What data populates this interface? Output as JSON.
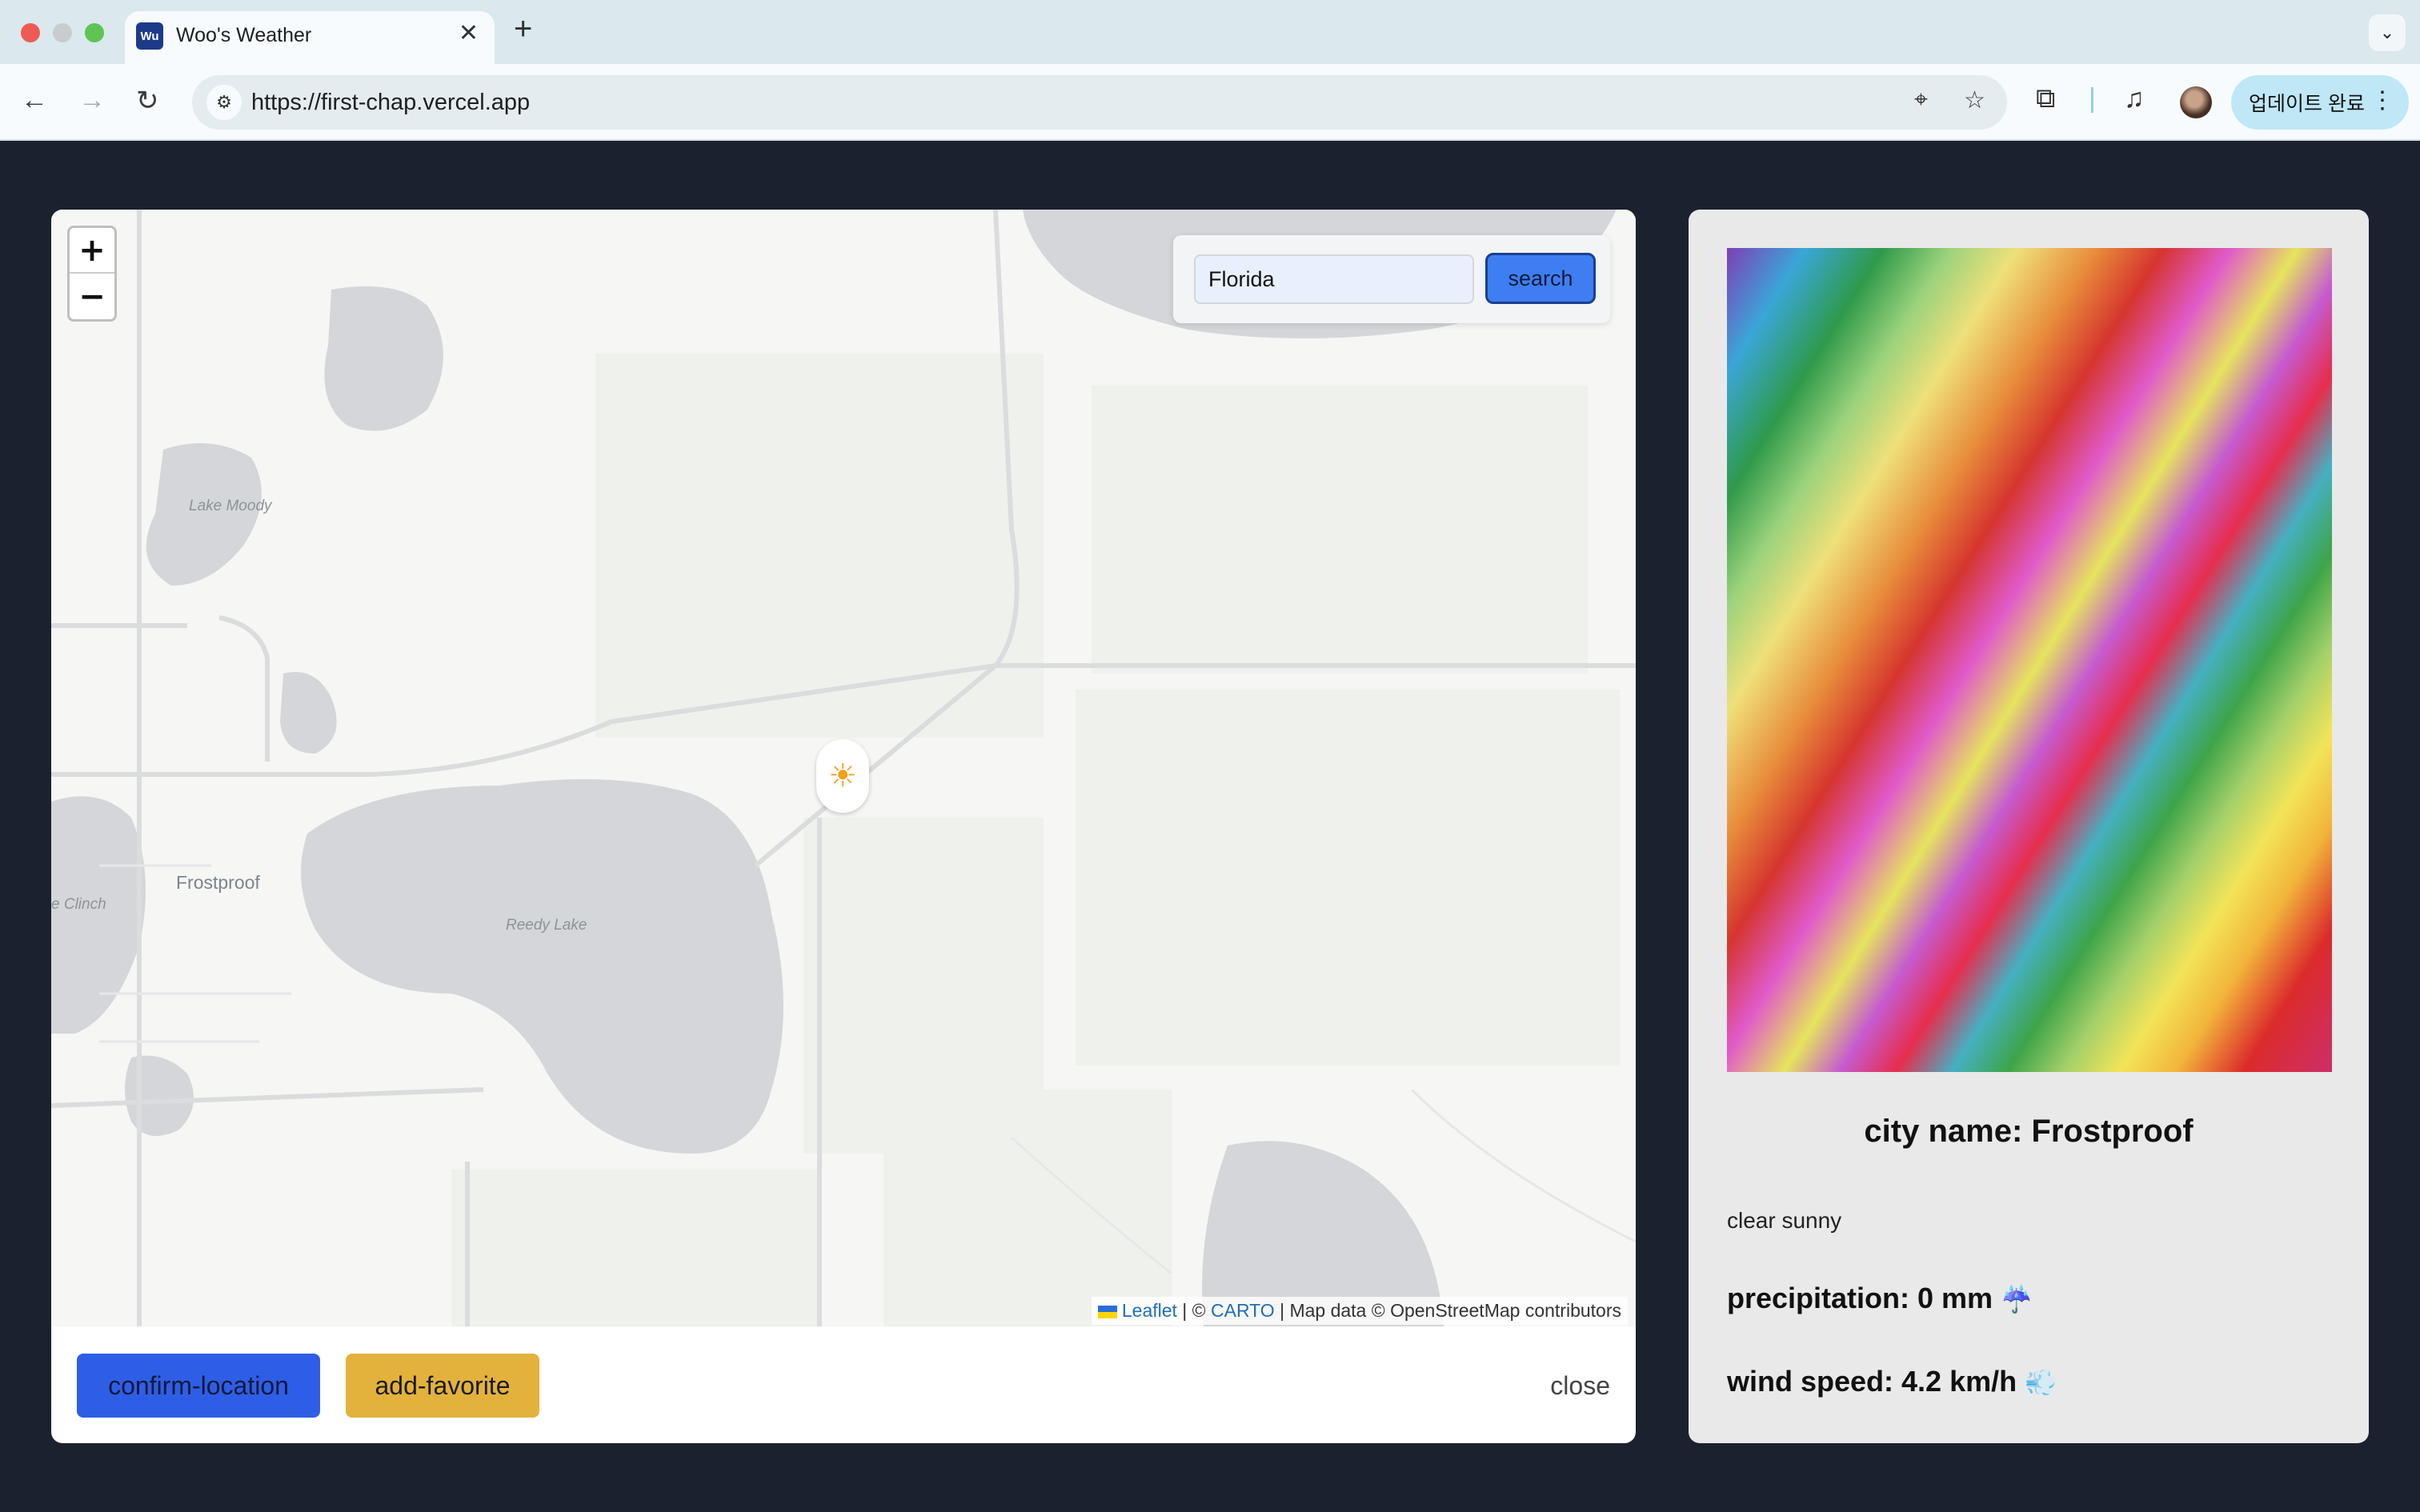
{
  "browser": {
    "tab_title": "Woo's Weather",
    "tab_favicon": "Wu",
    "url": "https://first-chap.vercel.app",
    "update_label": "업데이트 완료"
  },
  "search": {
    "value": "Florida",
    "button": "search"
  },
  "map": {
    "zoom_in": "+",
    "zoom_out": "−",
    "labels": [
      "Lake Moody",
      "Frostproof",
      "e Clinch",
      "Reedy Lake"
    ],
    "marker_icon": "☀",
    "attribution": {
      "leaflet": "Leaflet",
      "sep1": " | © ",
      "carto": "CARTO",
      "rest": " | Map data © OpenStreetMap contributors"
    }
  },
  "actions": {
    "confirm": "confirm-location",
    "favorite": "add-favorite",
    "close": "close"
  },
  "weather": {
    "city": "city name: Frostproof",
    "description": "clear sunny",
    "precipitation": "precipitation: 0 mm",
    "precipitation_icon": "☔",
    "wind": "wind speed: 4.2 km/h",
    "wind_icon": "💨"
  }
}
